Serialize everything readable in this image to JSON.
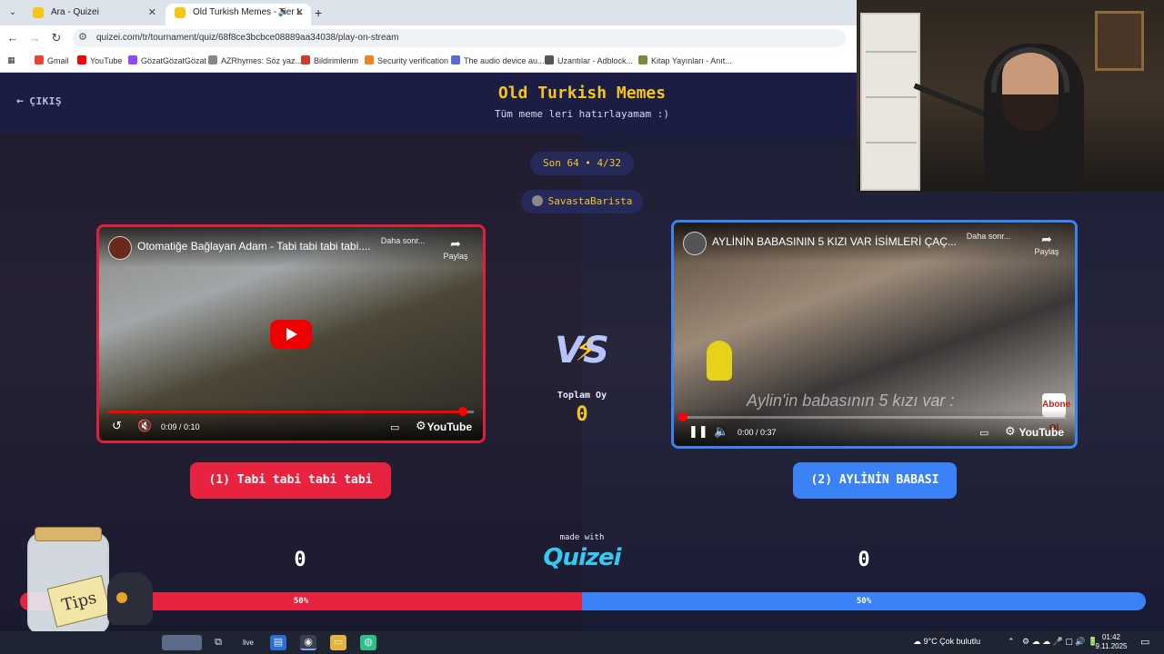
{
  "browser": {
    "tabs": [
      {
        "title": "Ara - Quizei",
        "close": "✕"
      },
      {
        "title": "Old Turkish Memes - Tier L",
        "close": "✕",
        "mute": "🔈"
      }
    ],
    "new_tab": "+",
    "url": "quizei.com/tr/tournament/quiz/68f8ce3bcbce08889aa34038/play-on-stream",
    "bookmarks": [
      {
        "label": "Gmail",
        "color": "#ea4335"
      },
      {
        "label": "YouTube",
        "color": "#ff0000"
      },
      {
        "label": "GözatGözatGözat",
        "color": "#9146ff"
      },
      {
        "label": "AZRhymes: Söz yaz...",
        "color": "#888888"
      },
      {
        "label": "Bildirimlerim",
        "color": "#d33a2c"
      },
      {
        "label": "Security verification",
        "color": "#f48120"
      },
      {
        "label": "The audio device au...",
        "color": "#5b6bd6"
      },
      {
        "label": "Uzantılar - Adblock...",
        "color": "#555555"
      },
      {
        "label": "Kitap Yayınları - Anıt...",
        "color": "#7a8a3a"
      }
    ]
  },
  "page": {
    "exit_label": "ÇIKIŞ",
    "title": "Old Turkish Memes",
    "subtitle": "Tüm meme leri hatırlayamam :)",
    "round_pill": "Son 64 • 4/32",
    "user_pill": "SavastaBarista",
    "vs": "VS",
    "total_label": "Toplam Oy",
    "total_value": "0",
    "made_with": "made with",
    "logo": "Quizei",
    "colors": {
      "title": "#f5c518",
      "red": "#e8233f",
      "blue": "#3b82f6"
    }
  },
  "left": {
    "video_title": "Otomatiğe Bağlayan Adam - Tabi tabi tabi tabi....",
    "watch_later": "Daha sonr...",
    "share": "Paylaş",
    "time": "0:09 / 0:10",
    "progress": 0.97,
    "youtube": "YouTube",
    "button": "(1) Tabi tabi tabi tabi",
    "score": "0",
    "percent": "50%"
  },
  "right": {
    "video_title": "AYLİNİN BABASININ 5 KIZI VAR İSİMLERİ ÇAÇ...",
    "watch_later": "Daha sonr...",
    "share": "Paylaş",
    "time": "0:00 / 0:37",
    "progress": 0.0,
    "youtube": "YouTube",
    "caption": "Aylin'in babasının 5 kızı var :",
    "channel_badge": "Abone Ol",
    "button": "(2) AYLİNİN BABASI",
    "score": "0",
    "percent": "50%"
  },
  "overlay": {
    "tips": "Tips"
  },
  "taskbar": {
    "weather": "9°C  Çok bulutlu",
    "time": "01:42",
    "date": "9.11.2025"
  }
}
